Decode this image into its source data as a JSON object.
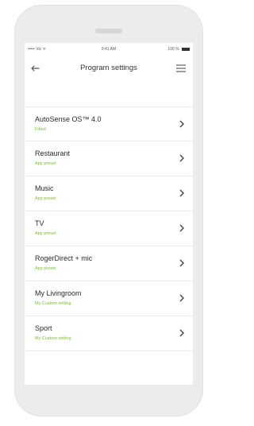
{
  "status": {
    "signal": "••••• Viz ᯤ",
    "time": "9:41 AM",
    "battery": "100 %"
  },
  "header": {
    "title": "Program settings"
  },
  "programs": [
    {
      "name": "AutoSense OS™ 4.0",
      "type": "Fitted"
    },
    {
      "name": "Restaurant",
      "type": "App preset"
    },
    {
      "name": "Music",
      "type": "App preset"
    },
    {
      "name": "TV",
      "type": "App preset"
    },
    {
      "name": "RogerDirect + mic",
      "type": "App preset"
    },
    {
      "name": "My Livingroom",
      "type": "My Custom setting"
    },
    {
      "name": "Sport",
      "type": "My Custom setting"
    }
  ],
  "colors": {
    "accent": "#7cbf2e"
  }
}
